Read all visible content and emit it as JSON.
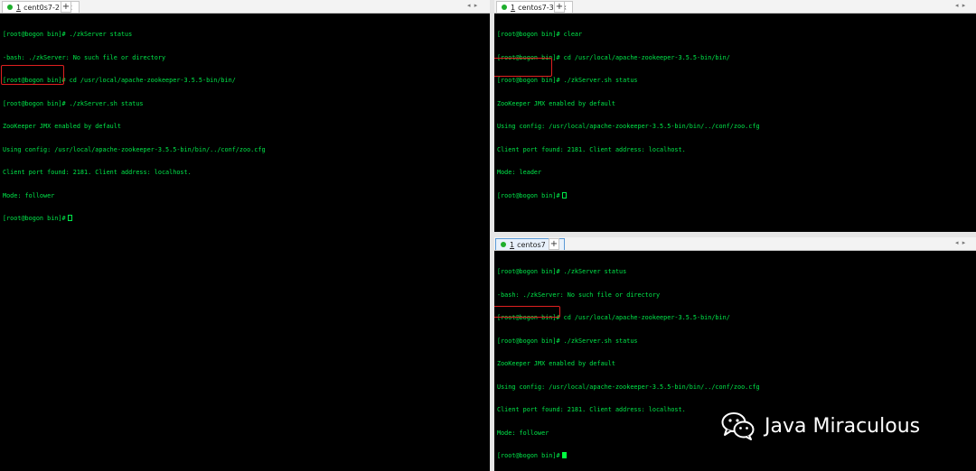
{
  "panes": {
    "left": {
      "tab": {
        "number": "1",
        "name": "cent0s7-2"
      },
      "lines": [
        "[root@bogon bin]# ./zkServer status",
        "-bash: ./zkServer: No such file or directory",
        "[root@bogon bin]# cd /usr/local/apache-zookeeper-3.5.5-bin/bin/",
        "[root@bogon bin]# ./zkServer.sh status",
        "ZooKeeper JMX enabled by default",
        "Using config: /usr/local/apache-zookeeper-3.5.5-bin/bin/../conf/zoo.cfg",
        "Client port found: 2181. Client address: localhost.",
        "Mode: follower",
        "[root@bogon bin]#"
      ]
    },
    "top_right": {
      "tab": {
        "number": "1",
        "name": "centos7-3"
      },
      "lines": [
        "[root@bogon bin]# clear",
        "[root@bogon bin]# cd /usr/local/apache-zookeeper-3.5.5-bin/bin/",
        "[root@bogon bin]# ./zkServer.sh status",
        "ZooKeeper JMX enabled by default",
        "Using config: /usr/local/apache-zookeeper-3.5.5-bin/bin/../conf/zoo.cfg",
        "Client port found: 2181. Client address: localhost.",
        "Mode: leader",
        "[root@bogon bin]#"
      ]
    },
    "bottom_right": {
      "tab": {
        "number": "1",
        "name": "centos7"
      },
      "lines": [
        "[root@bogon bin]# ./zkServer status",
        "-bash: ./zkServer: No such file or directory",
        "[root@bogon bin]# cd /usr/local/apache-zookeeper-3.5.5-bin/bin/",
        "[root@bogon bin]# ./zkServer.sh status",
        "ZooKeeper JMX enabled by default",
        "Using config: /usr/local/apache-zookeeper-3.5.5-bin/bin/../conf/zoo.cfg",
        "Client port found: 2181. Client address: localhost.",
        "Mode: follower",
        "[root@bogon bin]#"
      ]
    }
  },
  "watermark": {
    "text": "Java Miraculous",
    "icon": "wechat-icon"
  },
  "colors": {
    "terminal_bg": "#000000",
    "terminal_fg": "#00e84a",
    "highlight": "#e02020",
    "tab_dot": "#1dae2c"
  }
}
